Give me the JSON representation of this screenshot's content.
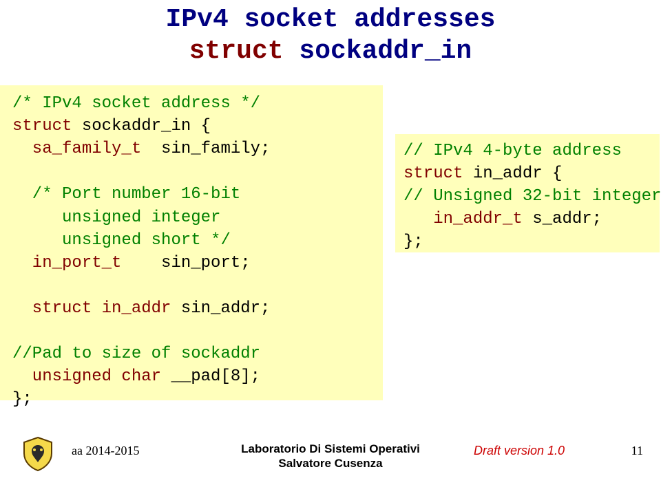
{
  "title": {
    "line1": "IPv4 socket addresses",
    "line2_kw": "struct",
    "line2_name": "sockaddr_in"
  },
  "left_box": {
    "l1": "/* IPv4 socket address */",
    "l2_kw": "struct",
    "l2_name": " sockaddr_in {",
    "l3_type": "  sa_family_t",
    "l3_name": "  sin_family;",
    "l5_c1": "  /* Port number 16-bit",
    "l6_c2": "     unsigned integer",
    "l7_c3": "     unsigned short */",
    "l8_type": "  in_port_t",
    "l8_name": "    sin_port;",
    "l10_kw": "  struct",
    "l10_type": " in_addr",
    "l10_name": " sin_addr;",
    "l12_c1": "//Pad to size of sockaddr",
    "l13_type": "  unsigned char",
    "l13_name": " __pad[8];",
    "l14": "};"
  },
  "right_box": {
    "l1": "// IPv4 4-byte address",
    "l2_kw": "struct",
    "l2_name": " in_addr {",
    "l3_c": "// Unsigned 32-bit integer",
    "l4_type": "   in_addr_t",
    "l4_name": " s_addr;",
    "l5": "};"
  },
  "footer": {
    "year": "aa 2014-2015",
    "lab_line1": "Laboratorio Di Sistemi Operativi",
    "lab_line2": "Salvatore Cusenza",
    "draft": "Draft version 1.0",
    "page": "11"
  }
}
